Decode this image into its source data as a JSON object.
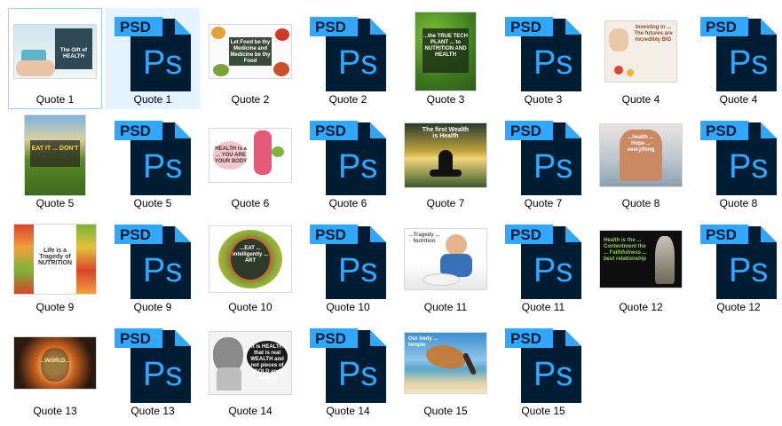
{
  "colors": {
    "psd_body": "#001d34",
    "psd_accent": "#31a8ff",
    "hover_bg": "#e5f3ff",
    "focus_border": "#99d1ff"
  },
  "psd_icon": {
    "badge_text": "PSD",
    "logo_text": "Ps"
  },
  "items": [
    {
      "label": "Quote 1",
      "type": "image"
    },
    {
      "label": "Quote 1",
      "type": "psd"
    },
    {
      "label": "Quote 2",
      "type": "image"
    },
    {
      "label": "Quote 2",
      "type": "psd"
    },
    {
      "label": "Quote 3",
      "type": "image"
    },
    {
      "label": "Quote 3",
      "type": "psd"
    },
    {
      "label": "Quote 4",
      "type": "image"
    },
    {
      "label": "Quote 4",
      "type": "psd"
    },
    {
      "label": "Quote 5",
      "type": "image"
    },
    {
      "label": "Quote 5",
      "type": "psd"
    },
    {
      "label": "Quote 6",
      "type": "image"
    },
    {
      "label": "Quote 6",
      "type": "psd"
    },
    {
      "label": "Quote 7",
      "type": "image"
    },
    {
      "label": "Quote 7",
      "type": "psd"
    },
    {
      "label": "Quote 8",
      "type": "image"
    },
    {
      "label": "Quote 8",
      "type": "psd"
    },
    {
      "label": "Quote 9",
      "type": "image"
    },
    {
      "label": "Quote 9",
      "type": "psd"
    },
    {
      "label": "Quote 10",
      "type": "image"
    },
    {
      "label": "Quote 10",
      "type": "psd"
    },
    {
      "label": "Quote 11",
      "type": "image"
    },
    {
      "label": "Quote 11",
      "type": "psd"
    },
    {
      "label": "Quote 12",
      "type": "image"
    },
    {
      "label": "Quote 12",
      "type": "psd"
    },
    {
      "label": "Quote 13",
      "type": "image"
    },
    {
      "label": "Quote 13",
      "type": "psd"
    },
    {
      "label": "Quote 14",
      "type": "image"
    },
    {
      "label": "Quote 14",
      "type": "psd"
    },
    {
      "label": "Quote 15",
      "type": "image"
    },
    {
      "label": "Quote 15",
      "type": "psd"
    }
  ],
  "thumb_text": {
    "q1": "The Gift of HEALTH",
    "q2": "Let Food be thy Medicine and Medicine be thy Food",
    "q3": "...the TRUE TECH PLANT ... to NUTRITION AND HEALTH",
    "q4": "Investing in ... The futures are incredibly BIG",
    "q5": "EAT IT ... DON'T",
    "q6": "HEALTH is a ... YOU ARE YOUR BODY",
    "q7": "The first Wealth is Health",
    "q8": "...health ... Hope ... everything",
    "q9": "Life is a Tragedy of NUTRITION",
    "q10": "...EAT ... intelligently ... ART",
    "q11": "...Tragedy ... Nutrition",
    "q12": "Health is the ... Contentment the ... Faithfulness ... best relationship",
    "q13": "...WORLD...",
    "q14": "It is HEALTH that is real WEALTH and not pieces of GOLD and SILVER",
    "q15": "Our body ... temple"
  }
}
